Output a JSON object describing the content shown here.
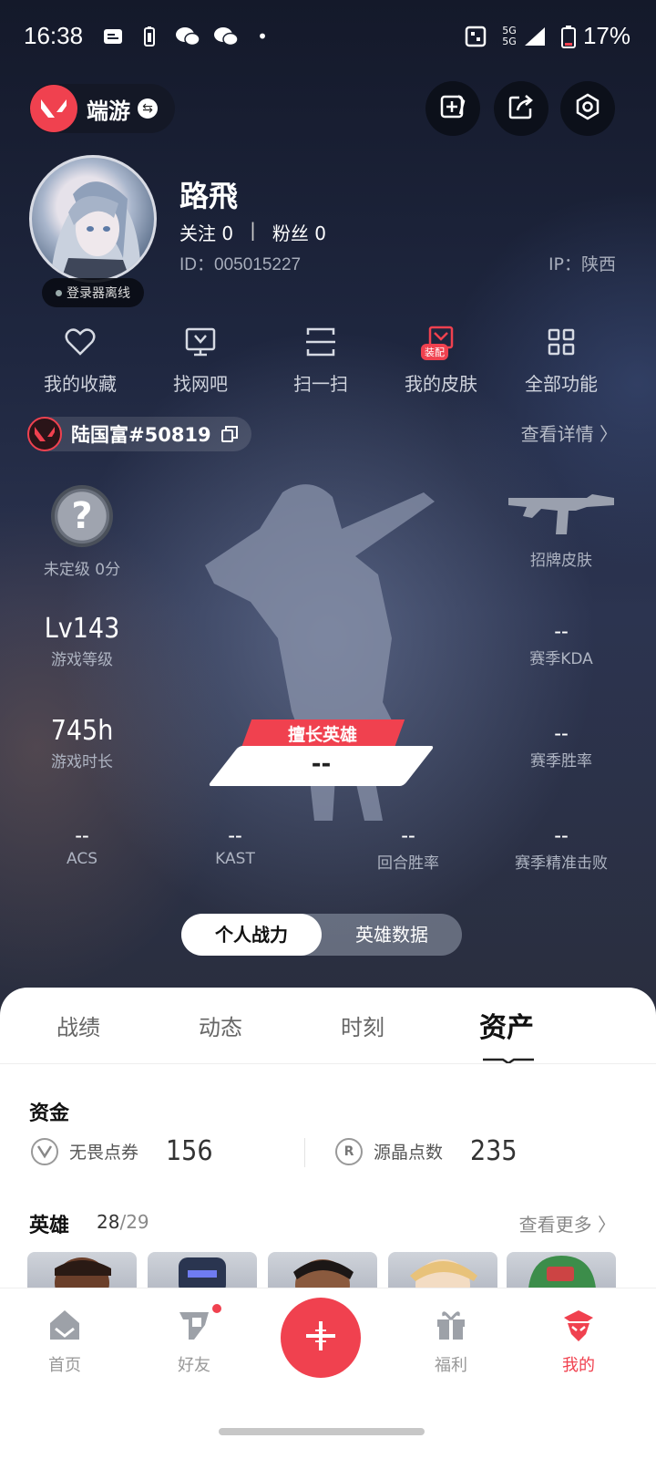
{
  "status_bar": {
    "time": "16:38",
    "network": "5G 5G",
    "battery": "17%"
  },
  "header": {
    "game_name": "端游",
    "icons": [
      "edit-card-icon",
      "share-icon",
      "settings-hex-icon"
    ]
  },
  "profile": {
    "nickname": "路飛",
    "following_label": "关注",
    "following_count": "0",
    "fans_label": "粉丝",
    "fans_count": "0",
    "separator": "|",
    "id_text": "ID：005015227",
    "ip_text": "IP：陕西",
    "login_status": "登录器离线"
  },
  "quick_functions": [
    {
      "label": "我的收藏",
      "icon": "heart-icon"
    },
    {
      "label": "找网吧",
      "icon": "monitor-icon"
    },
    {
      "label": "扫一扫",
      "icon": "scan-icon"
    },
    {
      "label": "我的皮肤",
      "icon": "skin-icon",
      "tag": "装配"
    },
    {
      "label": "全部功能",
      "icon": "grid-icon"
    }
  ],
  "account": {
    "name": "陆国富#50819",
    "detail_link": "查看详情 〉"
  },
  "stats": {
    "rank": {
      "value": "?",
      "label": "未定级 0分"
    },
    "level": {
      "value": "Lv143",
      "label": "游戏等级"
    },
    "playtime": {
      "value": "745h",
      "label": "游戏时长"
    },
    "skin": {
      "label": "招牌皮肤"
    },
    "kda": {
      "value": "--",
      "label": "赛季KDA"
    },
    "winrate": {
      "value": "--",
      "label": "赛季胜率"
    },
    "acs": {
      "value": "--",
      "label": "ACS"
    },
    "kast": {
      "value": "--",
      "label": "KAST"
    },
    "round_winrate": {
      "value": "--",
      "label": "回合胜率"
    },
    "precise_kills": {
      "value": "--",
      "label": "赛季精准击败"
    },
    "best_hero": {
      "tag": "擅长英雄",
      "value": "--"
    }
  },
  "toggle": {
    "active": "个人战力",
    "inactive": "英雄数据"
  },
  "tabs": [
    "战绩",
    "动态",
    "时刻",
    "资产"
  ],
  "active_tab": "资产",
  "assets": {
    "funds_title": "资金",
    "funds": [
      {
        "label": "无畏点券",
        "value": "156",
        "icon": "valorant-points-icon"
      },
      {
        "label": "源晶点数",
        "value": "235",
        "icon": "radianite-points-icon"
      }
    ],
    "heroes_title": "英雄",
    "heroes_owned": "28",
    "heroes_total": "/29",
    "more_link": "查看更多 〉"
  },
  "bottom_nav": [
    {
      "label": "首页",
      "icon": "home-icon"
    },
    {
      "label": "好友",
      "icon": "friends-icon"
    },
    {
      "label": "福利",
      "icon": "gift-icon"
    },
    {
      "label": "我的",
      "icon": "me-icon"
    }
  ],
  "colors": {
    "accent": "#f0414f",
    "bg_dark": "#1f2740",
    "sheet": "#ffffff"
  }
}
